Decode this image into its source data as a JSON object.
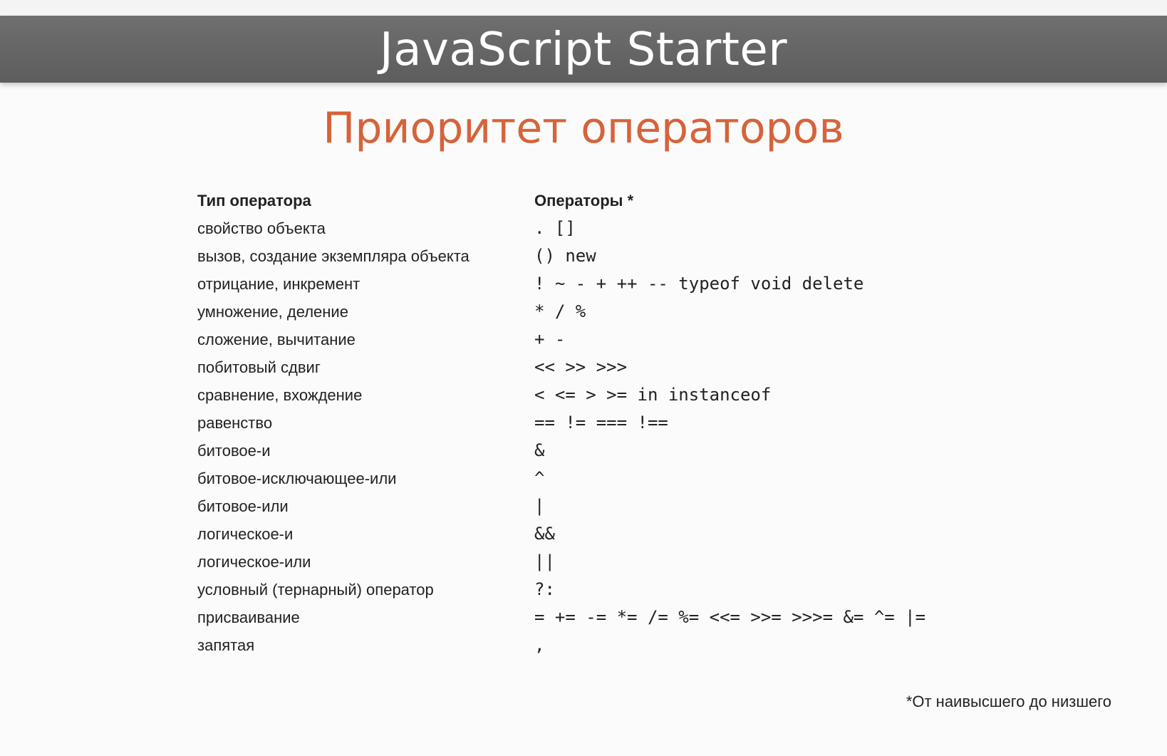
{
  "banner": {
    "title": "JavaScript Starter"
  },
  "slide": {
    "title": "Приоритет операторов"
  },
  "table": {
    "headers": {
      "type": "Тип оператора",
      "operators": "Операторы *"
    },
    "rows": [
      {
        "type": "свойство объекта",
        "operators": ". []"
      },
      {
        "type": "вызов, создание экземпляра объекта",
        "operators": "() new"
      },
      {
        "type": "отрицание, инкремент",
        "operators": "! ~ - + ++ -- typeof void delete"
      },
      {
        "type": "умножение, деление",
        "operators": "* / %"
      },
      {
        "type": "сложение, вычитание",
        "operators": "+ -"
      },
      {
        "type": "побитовый сдвиг",
        "operators": "<< >> >>>"
      },
      {
        "type": "сравнение, вхождение",
        "operators": "< <= > >= in instanceof"
      },
      {
        "type": "равенство",
        "operators": "== != === !=="
      },
      {
        "type": "битовое-и",
        "operators": "&"
      },
      {
        "type": "битовое-исключающее-или",
        "operators": "^"
      },
      {
        "type": "битовое-или",
        "operators": "|"
      },
      {
        "type": "логическое-и",
        "operators": "&&"
      },
      {
        "type": "логическое-или",
        "operators": "||"
      },
      {
        "type": "условный (тернарный) оператор",
        "operators": "?:"
      },
      {
        "type": "присваивание",
        "operators": "= += -= *= /= %= <<= >>= >>>= &= ^= |="
      },
      {
        "type": "запятая",
        "operators": ","
      }
    ]
  },
  "footnote": "*От наивысшего до низшего"
}
